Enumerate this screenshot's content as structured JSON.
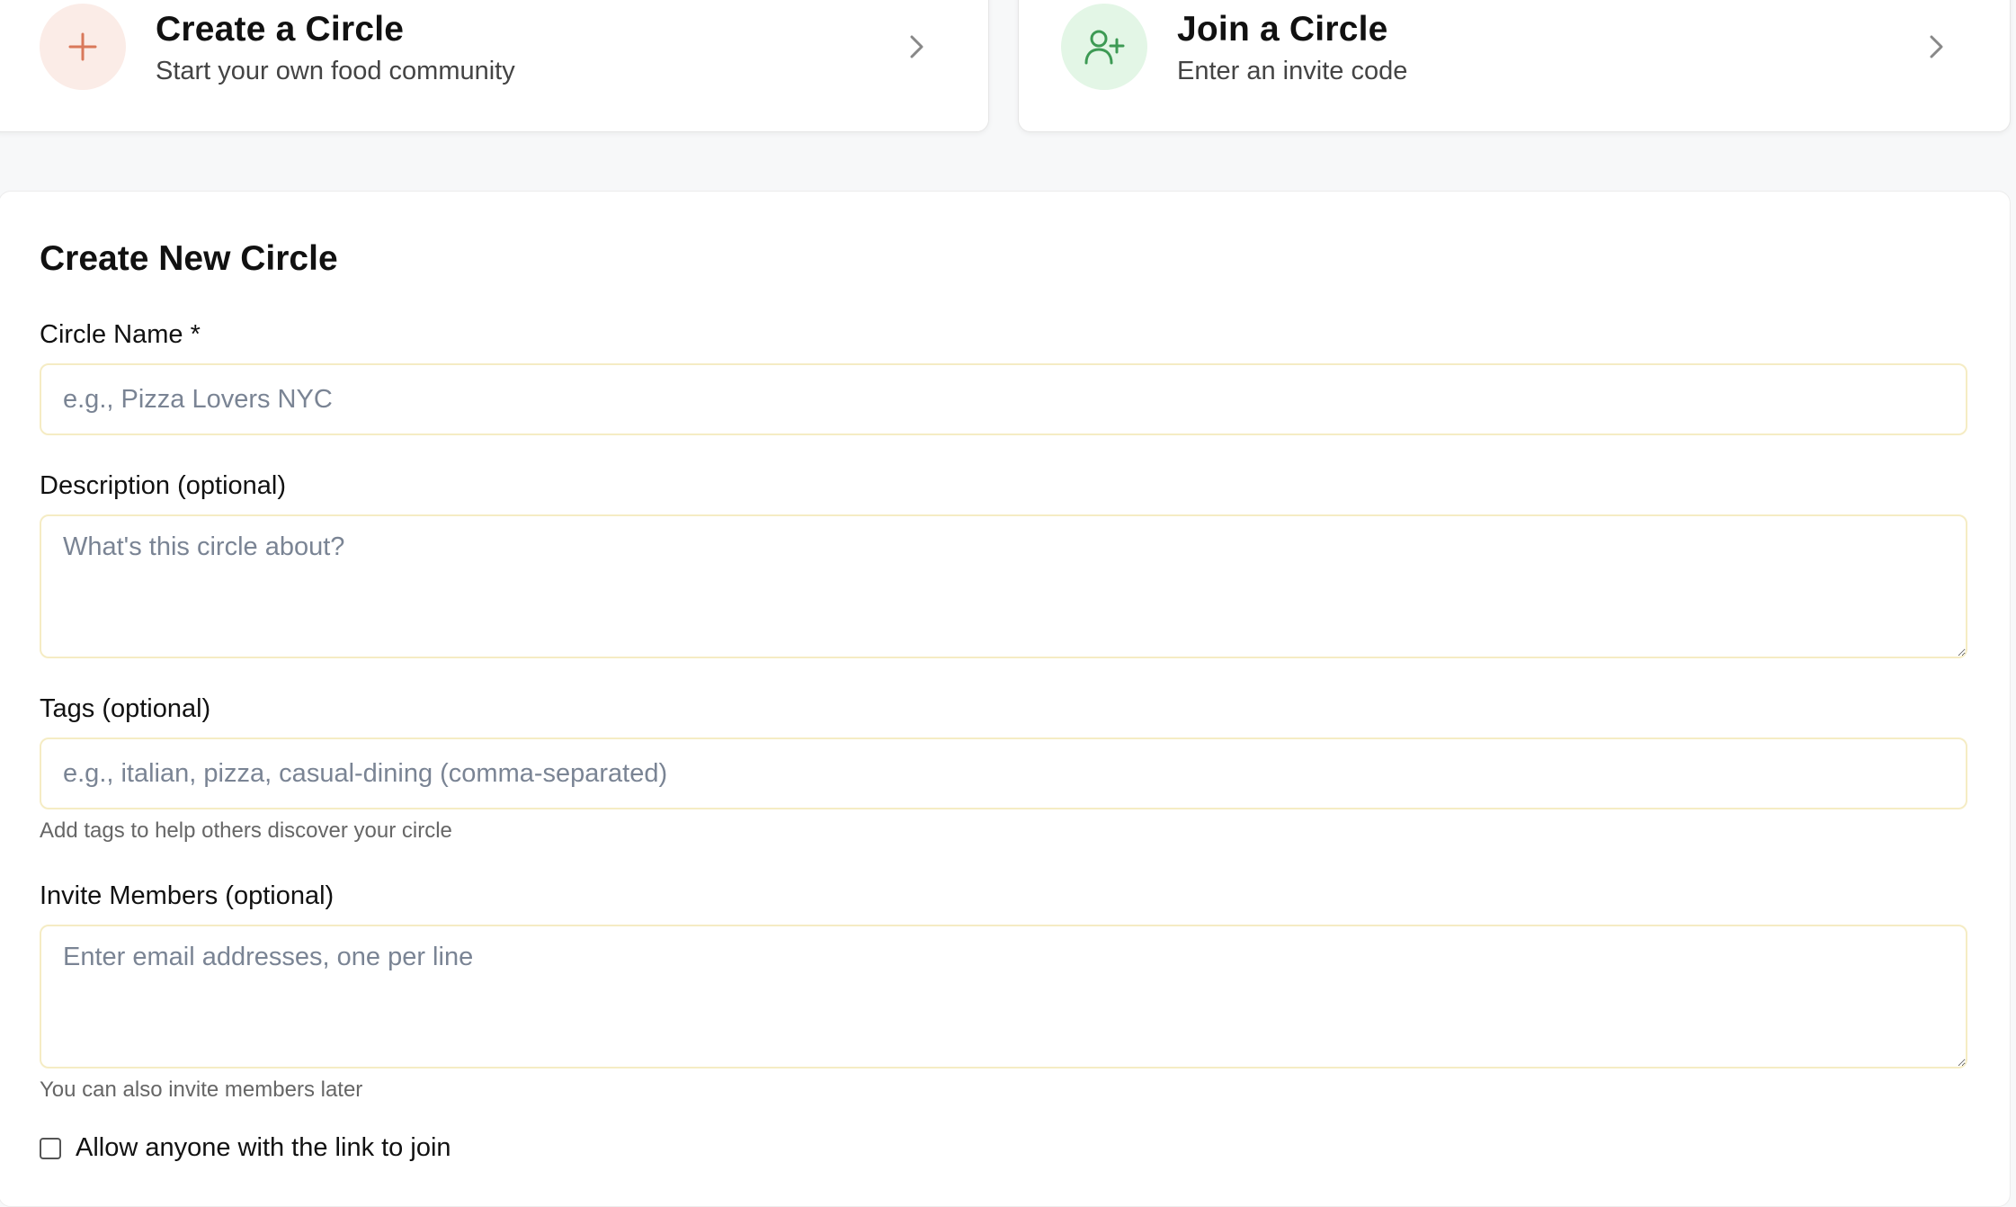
{
  "cards": {
    "create": {
      "title": "Create a Circle",
      "subtitle": "Start your own food community",
      "icon": "plus-icon",
      "accent": "#d9785a"
    },
    "join": {
      "title": "Join a Circle",
      "subtitle": "Enter an invite code",
      "icon": "user-plus-icon",
      "accent": "#3d9a54"
    }
  },
  "form": {
    "title": "Create New Circle",
    "name": {
      "label": "Circle Name *",
      "placeholder": "e.g., Pizza Lovers NYC",
      "value": ""
    },
    "description": {
      "label": "Description (optional)",
      "placeholder": "What's this circle about?",
      "value": ""
    },
    "tags": {
      "label": "Tags (optional)",
      "placeholder": "e.g., italian, pizza, casual-dining (comma-separated)",
      "value": "",
      "hint": "Add tags to help others discover your circle"
    },
    "invite": {
      "label": "Invite Members (optional)",
      "placeholder": "Enter email addresses, one per line",
      "value": "",
      "hint": "You can also invite members later"
    },
    "allow_link": {
      "label": "Allow anyone with the link to join",
      "checked": false
    }
  }
}
